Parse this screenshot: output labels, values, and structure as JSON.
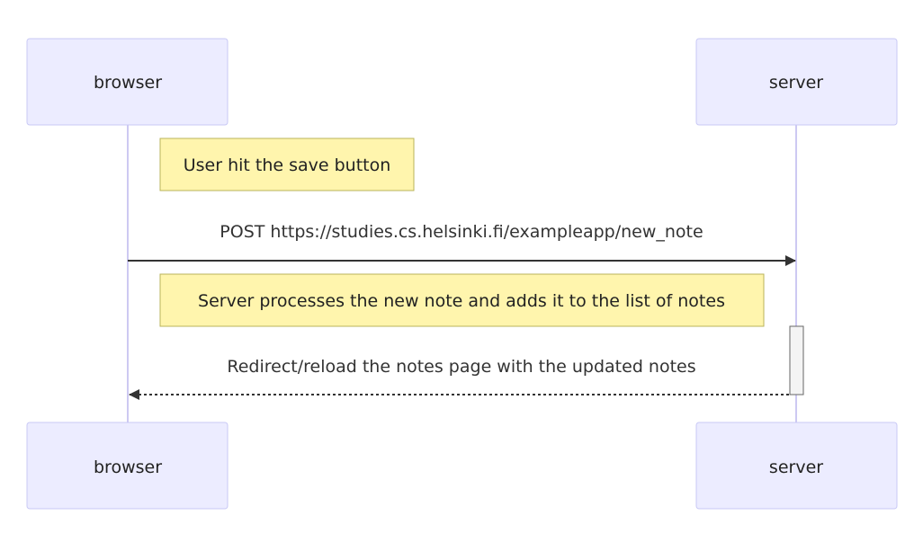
{
  "actors": {
    "browser": "browser",
    "server": "server"
  },
  "notes": {
    "save": "User hit the save button",
    "process": "Server processes the new note and adds it to the list of notes"
  },
  "messages": {
    "post": "POST https://studies.cs.helsinki.fi/exampleapp/new_note",
    "redirect": "Redirect/reload the notes page with the updated notes"
  },
  "colors": {
    "actor_fill": "#ececff",
    "actor_stroke": "#c9c9f5",
    "note_fill": "#fff5ad",
    "note_stroke": "#b8b35a",
    "line": "#333333"
  }
}
